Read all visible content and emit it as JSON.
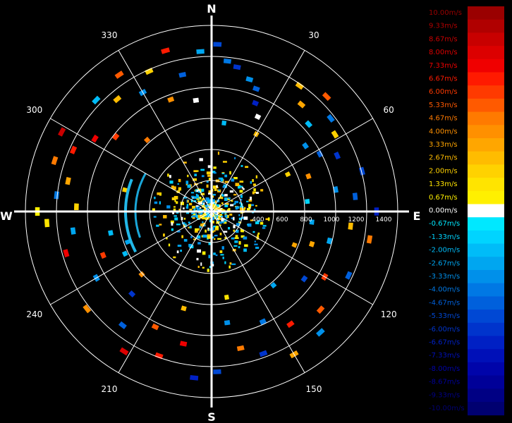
{
  "chart_data": {
    "type": "polar-radar-velocity",
    "compass": {
      "north": "N",
      "east": "E",
      "south": "S",
      "west": "W"
    },
    "bearing_labels": [
      "30",
      "60",
      "120",
      "150",
      "210",
      "240",
      "300",
      "330"
    ],
    "bearing_values": [
      30,
      60,
      120,
      150,
      210,
      240,
      300,
      330
    ],
    "radial_ticks": [
      "400",
      "600",
      "800",
      "1000",
      "1200",
      "1400"
    ],
    "range_ring_values": [
      400,
      600,
      800,
      1000,
      1200,
      1400
    ],
    "spokes_every_deg": 30,
    "colorbar": {
      "unit": "m/s",
      "labels": [
        "10.00m/s",
        "9.33m/s",
        "8.67m/s",
        "8.00m/s",
        "7.33m/s",
        "6.67m/s",
        "6.00m/s",
        "5.33m/s",
        "4.67m/s",
        "4.00m/s",
        "3.33m/s",
        "2.67m/s",
        "2.00m/s",
        "1.33m/s",
        "0.67m/s",
        "0.00m/s",
        "-0.67m/s",
        "-1.33m/s",
        "-2.00m/s",
        "-2.67m/s",
        "-3.33m/s",
        "-4.00m/s",
        "-4.67m/s",
        "-5.33m/s",
        "-6.00m/s",
        "-6.67m/s",
        "-7.33m/s",
        "-8.00m/s",
        "-8.67m/s",
        "-9.33m/s",
        "-10.00m/s"
      ],
      "colors": [
        "#9a0000",
        "#b00000",
        "#c80000",
        "#dc0000",
        "#f00000",
        "#ff1a00",
        "#ff3a00",
        "#ff5a00",
        "#ff7a00",
        "#ff9000",
        "#ffa600",
        "#ffbc00",
        "#ffd200",
        "#ffe400",
        "#fff000",
        "#ffffff",
        "#00e8ff",
        "#00d4ff",
        "#00bcf8",
        "#00a6f0",
        "#0090ea",
        "#0078e4",
        "#0060dc",
        "#0048d4",
        "#0034cc",
        "#0020c4",
        "#0010b8",
        "#0004aa",
        "#000098",
        "#000084",
        "#000070"
      ]
    },
    "echo_sectors": [
      {
        "az": 2,
        "r": 1440,
        "v": -5.33
      },
      {
        "az": 356,
        "r": 1380,
        "v": -2.67
      },
      {
        "az": 6,
        "r": 1300,
        "v": -4.0
      },
      {
        "az": 10,
        "r": 1260,
        "v": -6.0
      },
      {
        "az": 16,
        "r": 1180,
        "v": -3.33
      },
      {
        "az": 20,
        "r": 1120,
        "v": -4.67
      },
      {
        "az": 22,
        "r": 1000,
        "v": -6.67
      },
      {
        "az": 26,
        "r": 900,
        "v": 0.0
      },
      {
        "az": 35,
        "r": 1320,
        "v": 2.67
      },
      {
        "az": 40,
        "r": 1200,
        "v": 3.33
      },
      {
        "az": 45,
        "r": 1400,
        "v": 5.33
      },
      {
        "az": 48,
        "r": 1120,
        "v": -2.0
      },
      {
        "az": 52,
        "r": 1300,
        "v": -4.0
      },
      {
        "az": 55,
        "r": 980,
        "v": -3.33
      },
      {
        "az": 58,
        "r": 1250,
        "v": 2.0
      },
      {
        "az": 62,
        "r": 1050,
        "v": -4.67
      },
      {
        "az": 66,
        "r": 1180,
        "v": -6.0
      },
      {
        "az": 70,
        "r": 880,
        "v": 4.0
      },
      {
        "az": 75,
        "r": 1340,
        "v": -5.33
      },
      {
        "az": 80,
        "r": 1080,
        "v": -3.33
      },
      {
        "az": 84,
        "r": 1240,
        "v": -4.67
      },
      {
        "az": 90,
        "r": 1420,
        "v": -6.67
      },
      {
        "az": 96,
        "r": 1200,
        "v": 2.67
      },
      {
        "az": 100,
        "r": 1380,
        "v": 4.67
      },
      {
        "az": 104,
        "r": 1040,
        "v": -2.67
      },
      {
        "az": 108,
        "r": 900,
        "v": 3.33
      },
      {
        "az": 115,
        "r": 1300,
        "v": -4.67
      },
      {
        "az": 120,
        "r": 1120,
        "v": 6.0
      },
      {
        "az": 126,
        "r": 980,
        "v": -5.33
      },
      {
        "az": 132,
        "r": 1260,
        "v": 5.33
      },
      {
        "az": 138,
        "r": 1400,
        "v": -3.33
      },
      {
        "az": 145,
        "r": 1180,
        "v": 6.67
      },
      {
        "az": 150,
        "r": 1420,
        "v": 3.33
      },
      {
        "az": 155,
        "r": 1040,
        "v": -4.0
      },
      {
        "az": 160,
        "r": 1300,
        "v": -6.0
      },
      {
        "az": 168,
        "r": 1200,
        "v": 4.67
      },
      {
        "az": 172,
        "r": 960,
        "v": -3.33
      },
      {
        "az": 178,
        "r": 1380,
        "v": -5.33
      },
      {
        "az": 186,
        "r": 1440,
        "v": -6.67
      },
      {
        "az": 192,
        "r": 1160,
        "v": 7.33
      },
      {
        "az": 200,
        "r": 1320,
        "v": 6.67
      },
      {
        "az": 206,
        "r": 1100,
        "v": 5.33
      },
      {
        "az": 212,
        "r": 1420,
        "v": 8.0
      },
      {
        "az": 218,
        "r": 1240,
        "v": -4.67
      },
      {
        "az": 224,
        "r": 980,
        "v": -6.0
      },
      {
        "az": 232,
        "r": 1360,
        "v": 4.0
      },
      {
        "az": 240,
        "r": 1140,
        "v": -3.33
      },
      {
        "az": 248,
        "r": 1000,
        "v": 6.0
      },
      {
        "az": 254,
        "r": 1300,
        "v": 7.33
      },
      {
        "az": 262,
        "r": 1200,
        "v": -2.67
      },
      {
        "az": 266,
        "r": 1420,
        "v": 1.33
      },
      {
        "az": 270,
        "r": 1500,
        "v": 0.67
      },
      {
        "az": 272,
        "r": 1160,
        "v": 2.0
      },
      {
        "az": 276,
        "r": 1340,
        "v": -4.0
      },
      {
        "az": 282,
        "r": 1260,
        "v": 3.33
      },
      {
        "az": 288,
        "r": 1420,
        "v": 4.67
      },
      {
        "az": 294,
        "r": 1300,
        "v": 6.67
      },
      {
        "az": 298,
        "r": 1460,
        "v": 8.67
      },
      {
        "az": 302,
        "r": 1180,
        "v": 7.33
      },
      {
        "az": 308,
        "r": 1040,
        "v": 6.0
      },
      {
        "az": 314,
        "r": 1380,
        "v": -2.0
      },
      {
        "az": 320,
        "r": 1260,
        "v": 2.67
      },
      {
        "az": 326,
        "r": 1420,
        "v": 5.33
      },
      {
        "az": 330,
        "r": 1180,
        "v": -3.33
      },
      {
        "az": 336,
        "r": 1320,
        "v": 2.0
      },
      {
        "az": 340,
        "r": 1020,
        "v": 4.0
      },
      {
        "az": 344,
        "r": 1440,
        "v": 6.67
      },
      {
        "az": 348,
        "r": 1200,
        "v": -4.67
      },
      {
        "az": 352,
        "r": 960,
        "v": 0.0
      },
      {
        "az": 258,
        "r": 880,
        "v": -2.0
      },
      {
        "az": 250,
        "r": 760,
        "v": -2.67
      },
      {
        "az": 244,
        "r": 820,
        "v": -2.0
      },
      {
        "az": 30,
        "r": 760,
        "v": 2.67
      },
      {
        "az": 64,
        "r": 720,
        "v": 2.0
      },
      {
        "az": 112,
        "r": 760,
        "v": 3.33
      },
      {
        "az": 140,
        "r": 820,
        "v": -2.67
      },
      {
        "az": 170,
        "r": 740,
        "v": 1.33
      },
      {
        "az": 196,
        "r": 860,
        "v": 2.67
      },
      {
        "az": 228,
        "r": 800,
        "v": 4.0
      },
      {
        "az": 284,
        "r": 760,
        "v": 2.0
      },
      {
        "az": 318,
        "r": 820,
        "v": 4.67
      },
      {
        "az": 8,
        "r": 760,
        "v": -2.0
      },
      {
        "az": 84,
        "r": 820,
        "v": -1.33
      },
      {
        "az": 96,
        "r": 860,
        "v": -2.67
      }
    ]
  }
}
